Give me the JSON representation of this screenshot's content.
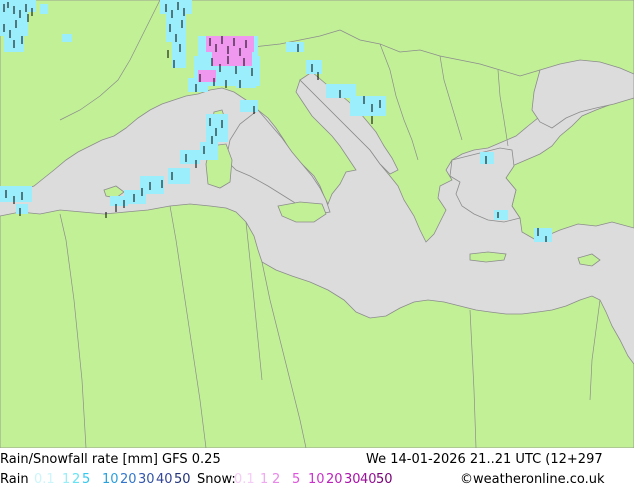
{
  "title": "Rain/Snowfall rate [mm] GFS 0.25",
  "valid_time": "We 14-01-2026 21..21 UTC (12+297",
  "legend": {
    "rain_label": "Rain",
    "rain_levels": [
      "0.1",
      "1",
      "2",
      "5",
      "10",
      "20",
      "30",
      "40",
      "50"
    ],
    "rain_colors": [
      "#ccf5fa",
      "#99eef8",
      "#66e3f4",
      "#33c7ee",
      "#2aa0dd",
      "#3377cc",
      "#3355aa",
      "#334499",
      "#223377"
    ],
    "snow_label": "Snow:",
    "snow_levels": [
      "0.1",
      "1",
      "2",
      "5",
      "10",
      "20",
      "30",
      "40",
      "50"
    ],
    "snow_colors": [
      "#f5ccf5",
      "#f0aaf0",
      "#e888e8",
      "#dd55dd",
      "#cc33cc",
      "#bb22bb",
      "#aa11aa",
      "#991199",
      "#770077"
    ]
  },
  "credit": "©weatheronline.co.uk",
  "map": {
    "sea_color": "#dcdcdc",
    "land_color": "#c2f097",
    "border_color": "#8c8c8c",
    "rain_color": "#9beefb",
    "snow_color": "#f098f0",
    "tick_color": "#000000"
  }
}
